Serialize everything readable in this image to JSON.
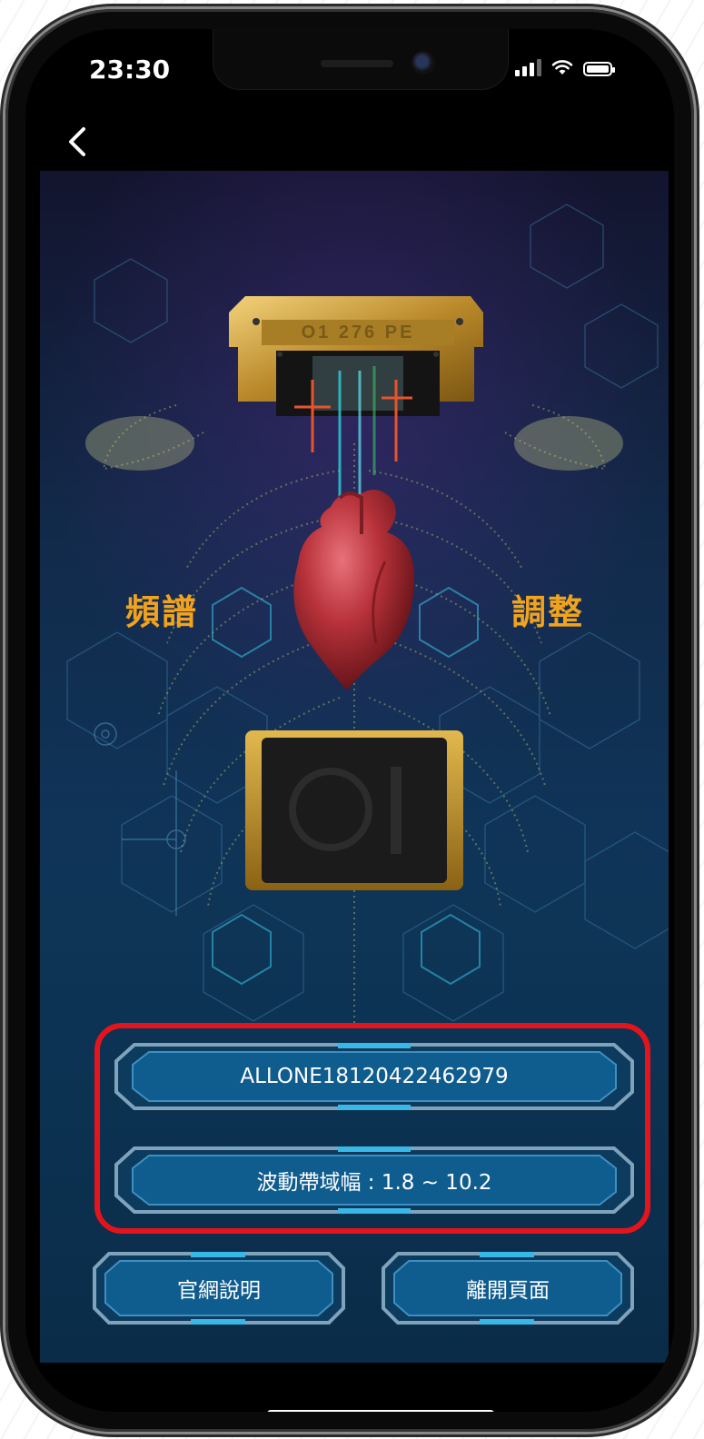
{
  "status": {
    "time": "23:30"
  },
  "device": {
    "top_plate_text": "O1 276 PE"
  },
  "labels": {
    "left": "頻譜",
    "right": "調整"
  },
  "info": {
    "device_id": "ALLONE18120422462979",
    "bandwidth": "波動帶域幅 : 1.8 ~ 10.2"
  },
  "buttons": {
    "official": "官網說明",
    "leave": "離開頁面"
  },
  "colors": {
    "accent_orange": "#f0a31e",
    "highlight_red": "#e3141c",
    "button_blue": "#0e5a8c"
  },
  "icons": {
    "back": "chevron-left-icon",
    "signal": "signal-bars-icon",
    "wifi": "wifi-icon",
    "battery": "battery-icon"
  }
}
